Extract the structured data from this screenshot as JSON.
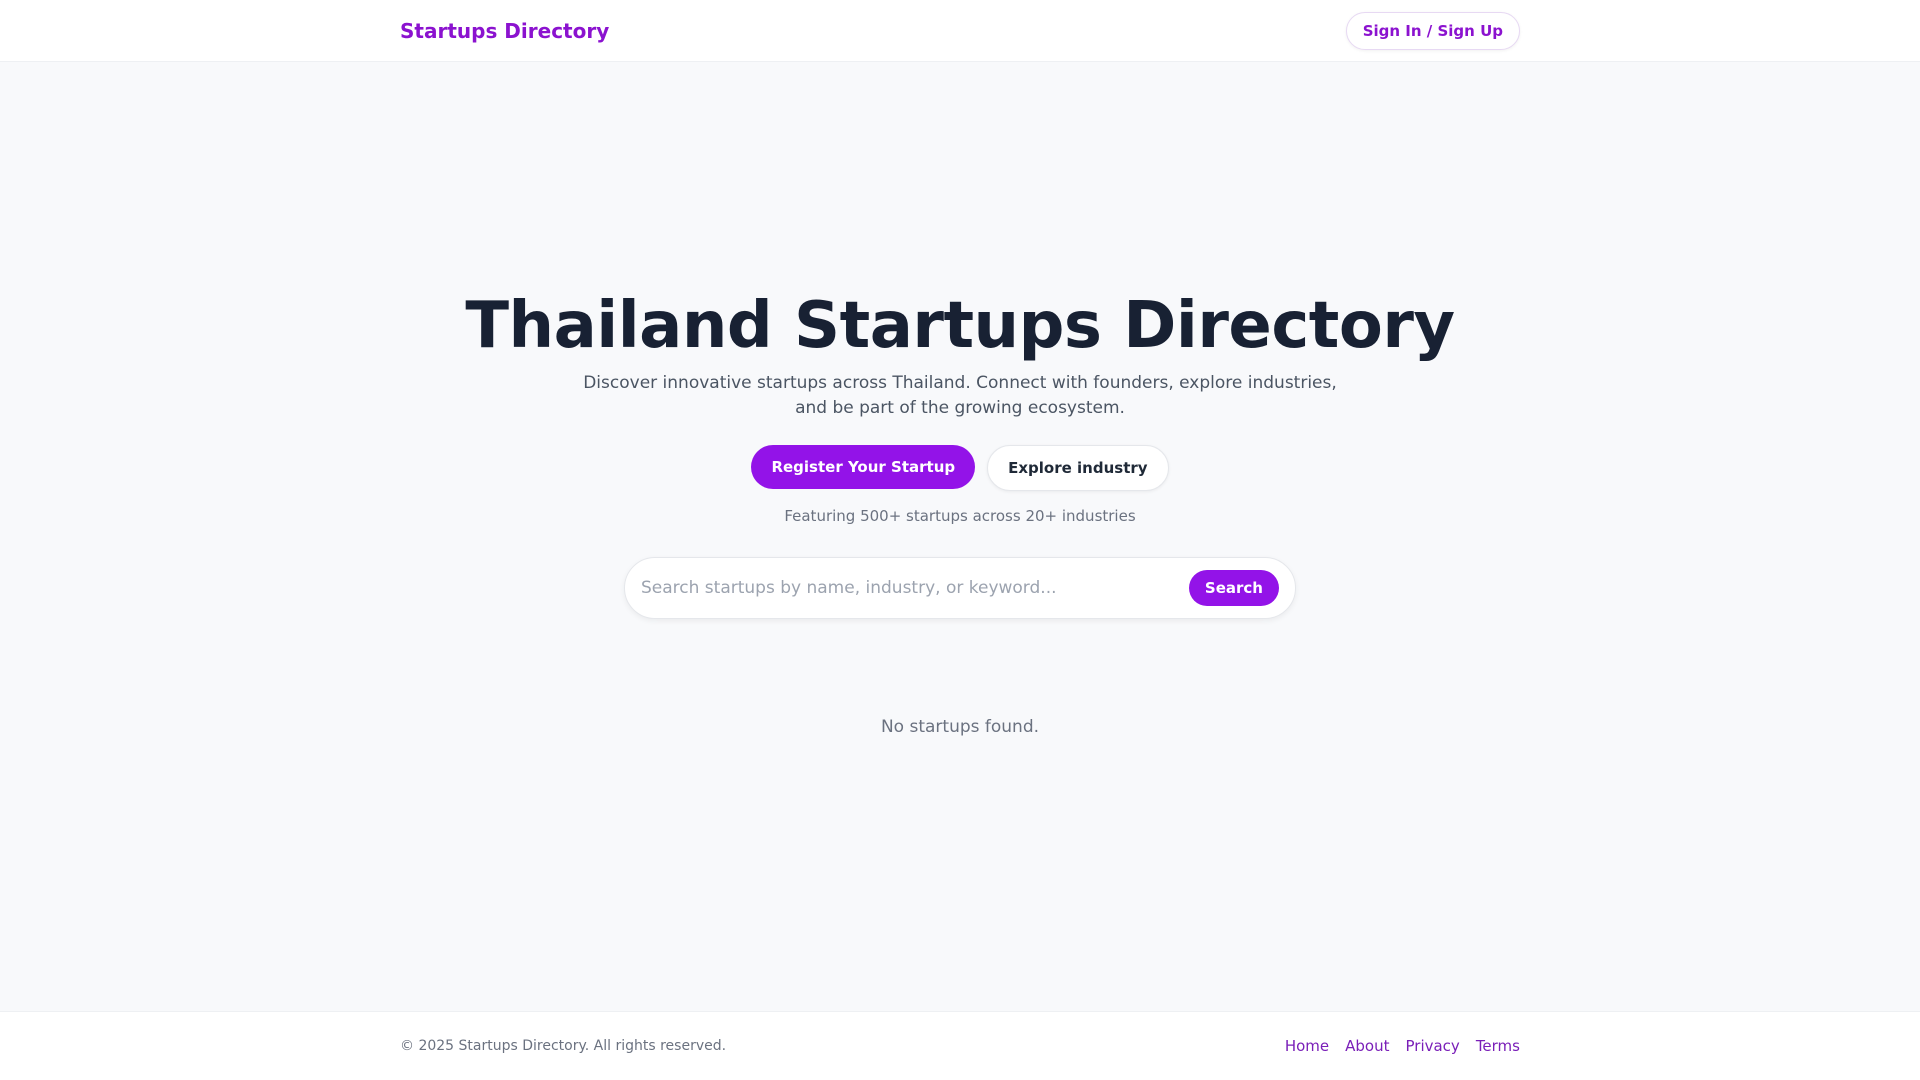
{
  "header": {
    "brand": "Startups Directory",
    "signin_label": "Sign In / Sign Up"
  },
  "hero": {
    "title": "Thailand Startups Directory",
    "subtitle": "Discover innovative startups across Thailand. Connect with founders, explore industries, and be part of the growing ecosystem.",
    "register_label": "Register Your Startup",
    "explore_label": "Explore industry",
    "featuring": "Featuring 500+ startups across 20+ industries"
  },
  "search": {
    "placeholder": "Search startups by name, industry, or keyword...",
    "value": "",
    "button_label": "Search"
  },
  "results": {
    "empty_message": "No startups found."
  },
  "footer": {
    "copyright": "© 2025 Startups Directory. All rights reserved.",
    "links": [
      "Home",
      "About",
      "Privacy",
      "Terms"
    ]
  },
  "colors": {
    "accent": "#9313e8",
    "brand": "#8b12cf",
    "background": "#f8f9fb"
  }
}
